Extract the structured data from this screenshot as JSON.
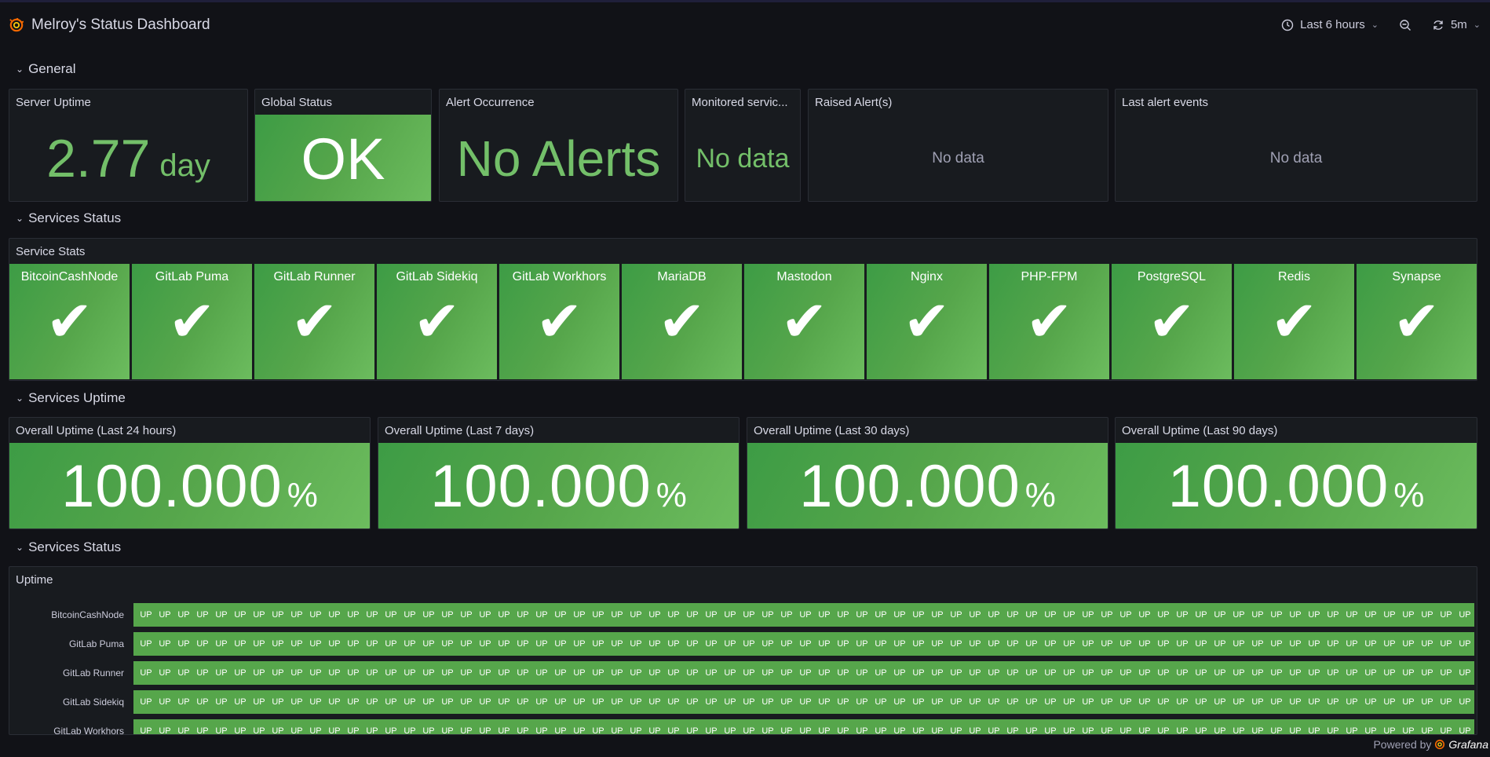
{
  "header": {
    "title": "Melroy's Status Dashboard",
    "time_range": "Last 6 hours",
    "refresh_interval": "5m"
  },
  "rows": {
    "general": "General",
    "services_status": "Services Status",
    "services_uptime": "Services Uptime",
    "services_status_2": "Services Status"
  },
  "general": {
    "server_uptime": {
      "title": "Server Uptime",
      "value": "2.77",
      "unit": "day"
    },
    "global_status": {
      "title": "Global Status",
      "value": "OK"
    },
    "alert_occurrence": {
      "title": "Alert Occurrence",
      "value": "No Alerts"
    },
    "monitored_services": {
      "title": "Monitored servic...",
      "value": "No data"
    },
    "raised_alerts": {
      "title": "Raised Alert(s)",
      "value": "No data"
    },
    "last_alert_events": {
      "title": "Last alert events",
      "value": "No data"
    }
  },
  "service_stats": {
    "title": "Service Stats",
    "check": "✔",
    "services": [
      "BitcoinCashNode",
      "GitLab Puma",
      "GitLab Runner",
      "GitLab Sidekiq",
      "GitLab Workhors",
      "MariaDB",
      "Mastodon",
      "Nginx",
      "PHP-FPM",
      "PostgreSQL",
      "Redis",
      "Synapse"
    ]
  },
  "uptime": {
    "panels": [
      {
        "title": "Overall Uptime (Last 24 hours)",
        "value": "100.000",
        "unit": "%"
      },
      {
        "title": "Overall Uptime (Last 7 days)",
        "value": "100.000",
        "unit": "%"
      },
      {
        "title": "Overall Uptime (Last 30 days)",
        "value": "100.000",
        "unit": "%"
      },
      {
        "title": "Overall Uptime (Last 90 days)",
        "value": "100.000",
        "unit": "%"
      }
    ]
  },
  "timeline": {
    "title": "Uptime",
    "state_label": "UP",
    "rows": [
      "BitcoinCashNode",
      "GitLab Puma",
      "GitLab Runner",
      "GitLab Sidekiq",
      "GitLab Workhors"
    ]
  },
  "footer": {
    "powered_by": "Powered by",
    "brand": "Grafana"
  },
  "colors": {
    "green": "#73bf69",
    "fill": "#56a64b",
    "bg": "#111217",
    "panel": "#181b1f"
  }
}
